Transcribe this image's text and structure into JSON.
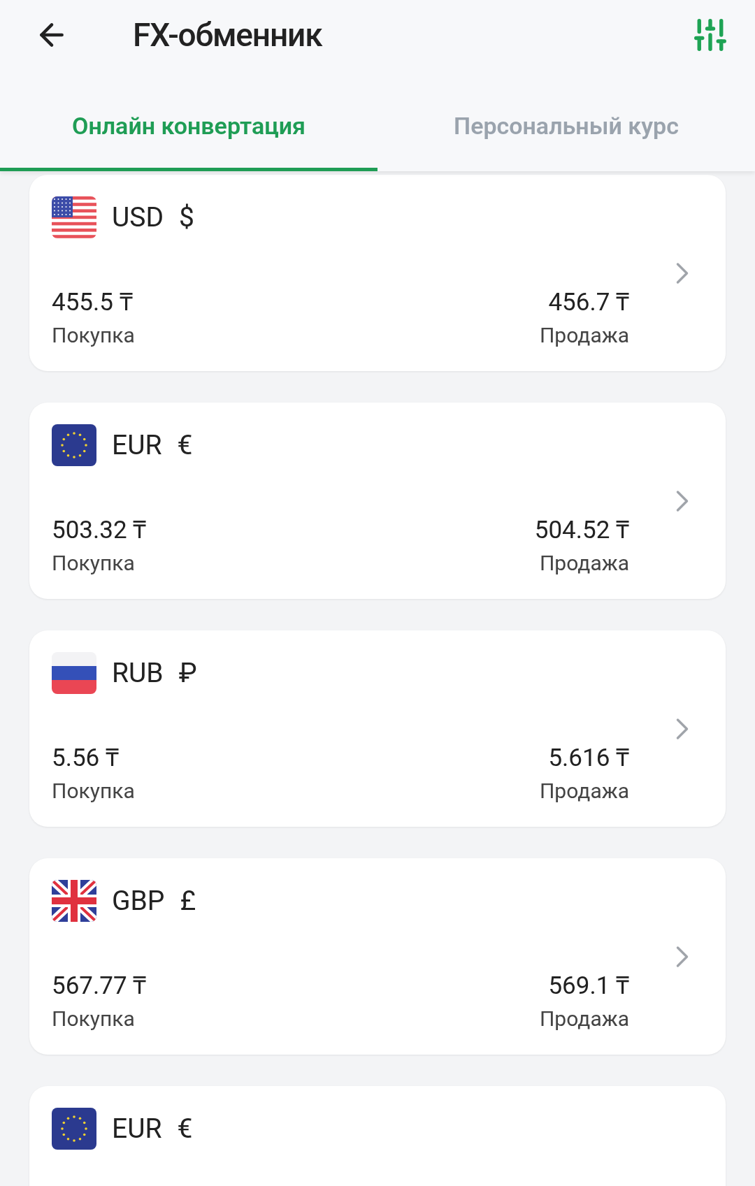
{
  "header": {
    "title": "FX-обменник"
  },
  "tabs": [
    {
      "label": "Онлайн конвертация",
      "selected": true
    },
    {
      "label": "Персональный курс",
      "selected": false
    }
  ],
  "currencies": [
    {
      "kind": "us",
      "code": "USD",
      "symbol": "$",
      "buy": "455.5 ₸",
      "buy_label": "Покупка",
      "sell": "456.7 ₸",
      "sell_label": "Продажа"
    },
    {
      "kind": "eu",
      "code": "EUR",
      "symbol": "€",
      "buy": "503.32 ₸",
      "buy_label": "Покупка",
      "sell": "504.52 ₸",
      "sell_label": "Продажа"
    },
    {
      "kind": "ru",
      "code": "RUB",
      "symbol": "₽",
      "buy": "5.56 ₸",
      "buy_label": "Покупка",
      "sell": "5.616 ₸",
      "sell_label": "Продажа"
    },
    {
      "kind": "gb",
      "code": "GBP",
      "symbol": "£",
      "buy": "567.77 ₸",
      "buy_label": "Покупка",
      "sell": "569.1 ₸",
      "sell_label": "Продажа"
    },
    {
      "kind": "eu",
      "code": "EUR",
      "symbol": "€"
    }
  ]
}
